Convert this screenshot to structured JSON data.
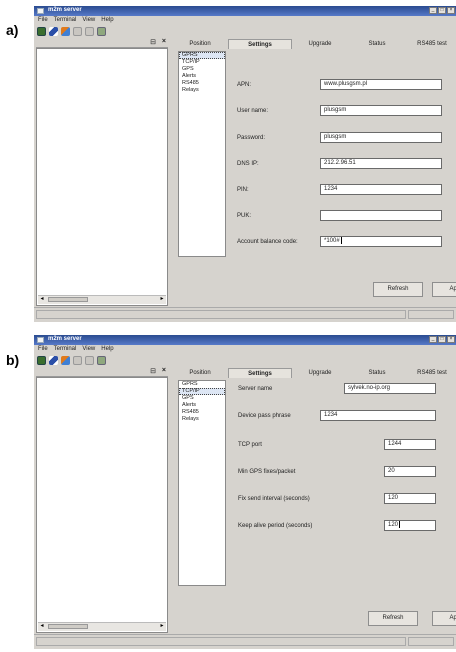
{
  "panel_a": {
    "label": "a)",
    "title": "m2m server",
    "menu": [
      "File",
      "Terminal",
      "View",
      "Help"
    ],
    "window_buttons": [
      "_",
      "□",
      "×"
    ],
    "left_panel": {
      "pin": "⊟",
      "close": "×",
      "scroll_left": "◂",
      "scroll_right": "▸"
    },
    "tabs": [
      "Position",
      "Settings",
      "Upgrade",
      "Status",
      "RS485 test"
    ],
    "active_tab": "Settings",
    "tree": [
      "GPRS",
      "TCP/IP",
      "GPS",
      "Alerts",
      "RS485",
      "Relays"
    ],
    "selected_tree": "GPRS",
    "fields": [
      {
        "label": "APN:",
        "value": "www.plusgsm.pl"
      },
      {
        "label": "User name:",
        "value": "plusgsm"
      },
      {
        "label": "Password:",
        "value": "plusgsm"
      },
      {
        "label": "DNS IP:",
        "value": "212.2.96.51"
      },
      {
        "label": "PIN:",
        "value": "1234"
      },
      {
        "label": "PUK:",
        "value": ""
      },
      {
        "label": "Account balance code:",
        "value": "*100#"
      }
    ],
    "refresh_label": "Refresh",
    "apply_label": "Apply"
  },
  "panel_b": {
    "label": "b)",
    "title": "m2m server",
    "menu": [
      "File",
      "Terminal",
      "View",
      "Help"
    ],
    "window_buttons": [
      "_",
      "□",
      "×"
    ],
    "left_panel": {
      "pin": "⊟",
      "close": "×",
      "scroll_left": "◂",
      "scroll_right": "▸"
    },
    "tabs": [
      "Position",
      "Settings",
      "Upgrade",
      "Status",
      "RS485 test"
    ],
    "active_tab": "Settings",
    "tree": [
      "GPRS",
      "TCP/IP",
      "GPS",
      "Alerts",
      "RS485",
      "Relays"
    ],
    "selected_tree": "TCP/IP",
    "fields": [
      {
        "label": "Server name",
        "value": "sylvek.no-ip.org"
      },
      {
        "label": "Device pass phrase",
        "value": "1234"
      },
      {
        "label": "TCP port",
        "value": "1244"
      },
      {
        "label": "Min GPS fixes/packet",
        "value": "20"
      },
      {
        "label": "Fix send interval (seconds)",
        "value": "120"
      },
      {
        "label": "Keep alive period (seconds)",
        "value": "120"
      }
    ],
    "refresh_label": "Refresh",
    "apply_label": "Apply"
  },
  "colors": {
    "titlebar": "#2a4b90",
    "window_bg": "#d6d3ce",
    "field_bg": "#ffffff"
  },
  "toolbar_icons": [
    "connect-icon",
    "edit-icon",
    "tools-icon",
    "save-icon",
    "copy-icon",
    "print-icon"
  ]
}
